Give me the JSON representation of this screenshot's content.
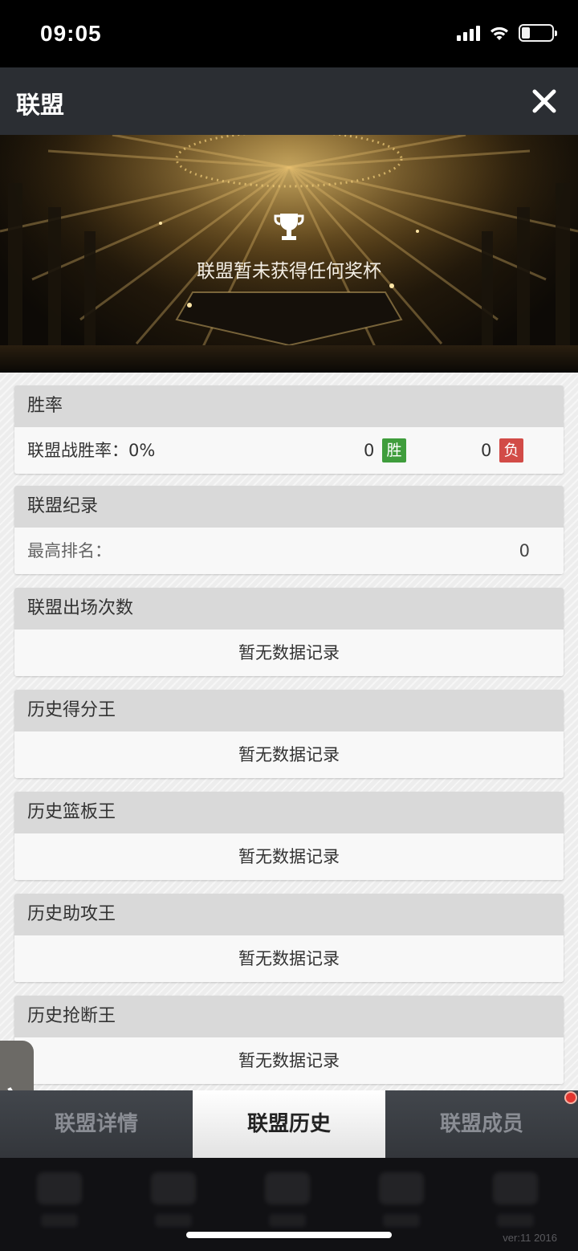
{
  "status_bar": {
    "time": "09:05"
  },
  "header": {
    "title": "联盟"
  },
  "banner": {
    "message": "联盟暂未获得任何奖杯"
  },
  "sections": {
    "win_rate": {
      "title": "胜率",
      "label": "联盟战胜率：0%",
      "wins": "0",
      "win_badge": "胜",
      "losses": "0",
      "loss_badge": "负",
      "win_color": "#3f9d3c",
      "loss_color": "#d24b47"
    },
    "record": {
      "title": "联盟纪录",
      "label": "最高排名：",
      "value": "0"
    },
    "appearances": {
      "title": "联盟出场次数",
      "empty": "暂无数据记录"
    },
    "scoring_king": {
      "title": "历史得分王",
      "empty": "暂无数据记录"
    },
    "rebound_king": {
      "title": "历史篮板王",
      "empty": "暂无数据记录"
    },
    "assist_king": {
      "title": "历史助攻王",
      "empty": "暂无数据记录"
    },
    "steal_king": {
      "title": "历史抢断王",
      "empty": "暂无数据记录"
    }
  },
  "side_handle": {
    "glyph": "〉"
  },
  "tabs": [
    {
      "label": "联盟详情",
      "active": false
    },
    {
      "label": "联盟历史",
      "active": true
    },
    {
      "label": "联盟成员",
      "active": false,
      "notification": true
    }
  ],
  "footer": {
    "version": "ver:11  2016"
  }
}
